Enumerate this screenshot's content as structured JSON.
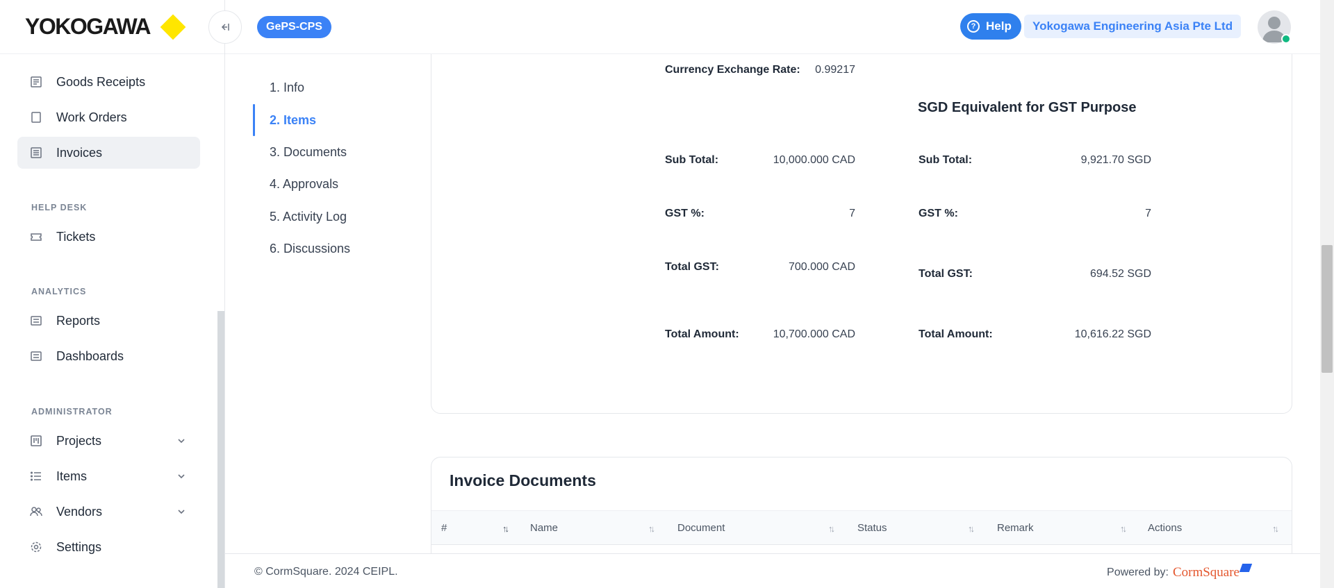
{
  "brand": {
    "logo_text": "YOKOGAWA",
    "accent": "#ffe600"
  },
  "header": {
    "app_name": "GePS-CPS",
    "help_label": "Help",
    "company": "Yokogawa Engineering Asia Pte Ltd",
    "collapse_icon": "collapse-left-icon"
  },
  "sidebar": {
    "items": [
      {
        "label": "Goods Receipts",
        "icon": "receipt-icon"
      },
      {
        "label": "Work Orders",
        "icon": "document-icon"
      },
      {
        "label": "Invoices",
        "icon": "invoice-icon",
        "active": true
      }
    ],
    "sections": [
      {
        "title": "HELP DESK",
        "items": [
          {
            "label": "Tickets",
            "icon": "ticket-icon"
          }
        ]
      },
      {
        "title": "ANALYTICS",
        "items": [
          {
            "label": "Reports",
            "icon": "report-icon"
          },
          {
            "label": "Dashboards",
            "icon": "dashboard-icon"
          }
        ]
      },
      {
        "title": "ADMINISTRATOR",
        "items": [
          {
            "label": "Projects",
            "icon": "kanban-icon",
            "expandable": true
          },
          {
            "label": "Items",
            "icon": "list-icon",
            "expandable": true
          },
          {
            "label": "Vendors",
            "icon": "users-icon",
            "expandable": true
          },
          {
            "label": "Settings",
            "icon": "gear-icon"
          }
        ]
      }
    ]
  },
  "steps": [
    "1. Info",
    "2. Items",
    "3. Documents",
    "4. Approvals",
    "5. Activity Log",
    "6. Discussions"
  ],
  "active_step": "2. Items",
  "summary": {
    "exchange_rate_label": "Currency Exchange Rate:",
    "exchange_rate_value": "0.99217",
    "gst_title": "SGD Equivalent for GST Purpose",
    "left": {
      "sub_total_label": "Sub Total:",
      "sub_total": "10,000.000 CAD",
      "gst_pct_label": "GST %:",
      "gst_pct": "7",
      "total_gst_label": "Total GST:",
      "total_gst": "700.000 CAD",
      "total_amount_label": "Total Amount:",
      "total_amount": "10,700.000 CAD"
    },
    "right": {
      "sub_total_label": "Sub Total:",
      "sub_total": "9,921.70 SGD",
      "gst_pct_label": "GST %:",
      "gst_pct": "7",
      "total_gst_label": "Total GST:",
      "total_gst": "694.52 SGD",
      "total_amount_label": "Total Amount:",
      "total_amount": "10,616.22 SGD"
    }
  },
  "documents": {
    "title": "Invoice Documents",
    "columns": [
      "#",
      "Name",
      "Document",
      "Status",
      "Remark",
      "Actions"
    ]
  },
  "footer": {
    "copyright": "© CormSquare. 2024 CEIPL.",
    "powered_by": "Powered by:",
    "brand": "CormSquare"
  },
  "colors": {
    "primary": "#3b82f6",
    "status_online": "#10b981"
  }
}
